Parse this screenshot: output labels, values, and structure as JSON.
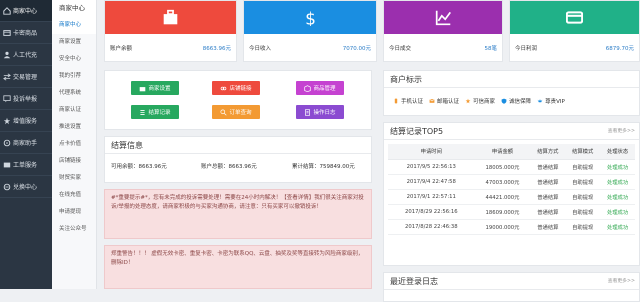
{
  "sidebar": {
    "items": [
      {
        "label": "商家中心",
        "icon": "home-icon",
        "active": true
      },
      {
        "label": "卡密商品",
        "icon": "card-icon",
        "active": false
      },
      {
        "label": "人工代充",
        "icon": "person-icon",
        "active": false
      },
      {
        "label": "交易管理",
        "icon": "trade-icon",
        "active": false
      },
      {
        "label": "投诉举报",
        "icon": "complaint-icon",
        "active": false
      },
      {
        "label": "增值服务",
        "icon": "service-icon",
        "active": false
      },
      {
        "label": "商家助手",
        "icon": "assistant-icon",
        "active": false
      },
      {
        "label": "工单服务",
        "icon": "ticket-icon",
        "active": false
      },
      {
        "label": "兑换中心",
        "icon": "exchange-icon",
        "active": false
      }
    ]
  },
  "subnav": {
    "title": "商家中心",
    "items": [
      "商家中心",
      "商家设置",
      "安全中心",
      "我的引荐",
      "代理系统",
      "商家认证",
      "推送设置",
      "点卡价值",
      "店铺链接",
      "财贸实家",
      "在线充值",
      "申请提现",
      "关注公众号"
    ],
    "active_index": 0
  },
  "stats": [
    {
      "label": "账户余额",
      "value": "8663.96元",
      "color": "#ee4a3d",
      "icon": "briefcase-icon"
    },
    {
      "label": "今日收入",
      "value": "7070.00元",
      "color": "#1a8ee1",
      "icon": "dollar-icon"
    },
    {
      "label": "今日成交",
      "value": "58笔",
      "color": "#9b2fae",
      "icon": "line-chart-icon"
    },
    {
      "label": "今日利润",
      "value": "6879.70元",
      "color": "#20b188",
      "icon": "credit-card-icon"
    }
  ],
  "actions": [
    {
      "label": "商家设置",
      "color": "#27a85f",
      "icon": "store-icon"
    },
    {
      "label": "店铺链接",
      "color": "#ee4a3d",
      "icon": "link-icon"
    },
    {
      "label": "商品管理",
      "color": "#c542d1",
      "icon": "goods-icon"
    },
    {
      "label": "结算记录",
      "color": "#27a85f",
      "icon": "list-icon"
    },
    {
      "label": "订单查询",
      "color": "#f39a33",
      "icon": "search-icon"
    },
    {
      "label": "操作日志",
      "color": "#8b4bd1",
      "icon": "log-icon"
    }
  ],
  "settlement": {
    "title": "结算信息",
    "available_label": "可用余额：",
    "available_value": "8663.96元",
    "total_label": "账户总额：",
    "total_value": "8663.96元",
    "cumulative_label": "累计结算：",
    "cumulative_value": "759849.00元"
  },
  "notice1": {
    "text": "#*重要提示#*，您有未完成的投诉需要处理！需要在24小时内解决！【查看详情】我们很关注商家对投诉/举报的处理态度，请商家积极的与买家沟通协商，请注意：只有买家可以撤销投诉！"
  },
  "notice2": {
    "text": "郑重警告！！！ 虚假无效卡密、重复卡密、卡密为联系QQ、云盘、抽奖及奖等直接转为风险商家级别，删除ID！"
  },
  "merchant_badges": {
    "title": "商户标示",
    "items": [
      {
        "label": "手机认证",
        "icon": "phone-icon",
        "color": "#f39a33"
      },
      {
        "label": "邮箱认证",
        "icon": "mail-icon",
        "color": "#f39a33"
      },
      {
        "label": "可信商家",
        "icon": "trust-icon",
        "color": "#f39a33"
      },
      {
        "label": "诚信保障",
        "icon": "shield-icon",
        "color": "#1a8ee1"
      },
      {
        "label": "尊贵VIP",
        "icon": "vip-icon",
        "color": "#1a8ee1"
      }
    ]
  },
  "top5": {
    "title": "结算记录TOP5",
    "more": "查看更多>>",
    "headers": [
      "申请时间",
      "申请金额",
      "结算方式",
      "结算模式",
      "处理状态"
    ],
    "rows": [
      [
        "2017/9/5 22:56:13",
        "18005.000元",
        "普通结算",
        "自助提现",
        "处理成功"
      ],
      [
        "2017/9/4 22:47:58",
        "47003.000元",
        "普通结算",
        "自助提现",
        "处理成功"
      ],
      [
        "2017/9/1 22:57:11",
        "44421.000元",
        "普通结算",
        "自助提现",
        "处理成功"
      ],
      [
        "2017/8/29 22:56:16",
        "18609.000元",
        "普通结算",
        "自助提现",
        "处理成功"
      ],
      [
        "2017/8/28 22:46:38",
        "19000.000元",
        "普通结算",
        "自助提现",
        "处理成功"
      ]
    ]
  },
  "recent_login": {
    "title": "最近登录日志",
    "more": "查看更多>>"
  }
}
